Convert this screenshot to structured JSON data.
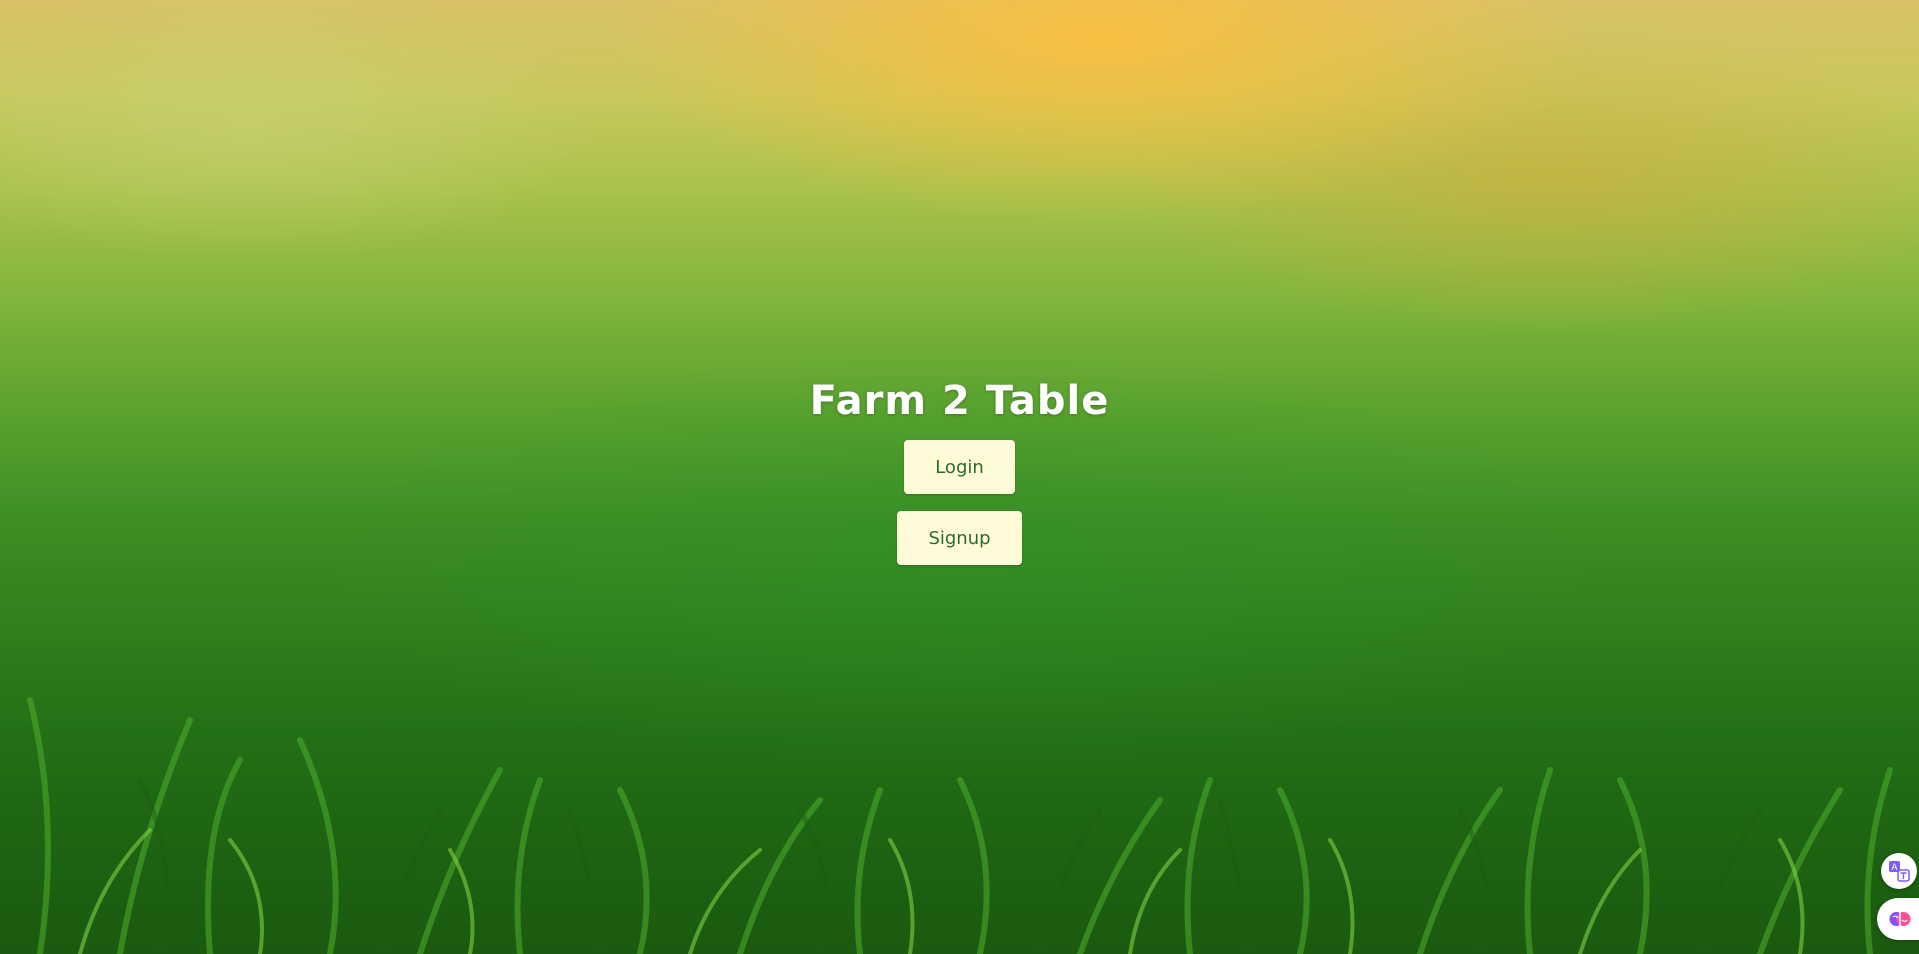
{
  "app": {
    "title": "Farm 2 Table"
  },
  "actions": {
    "login_label": "Login",
    "signup_label": "Signup"
  },
  "colors": {
    "button_bg": "#fffbd8",
    "button_text": "#2c6b2c",
    "title_text": "#ffffff"
  },
  "floating_widgets": [
    {
      "icon": "translate-icon"
    },
    {
      "icon": "brain-icon"
    }
  ]
}
